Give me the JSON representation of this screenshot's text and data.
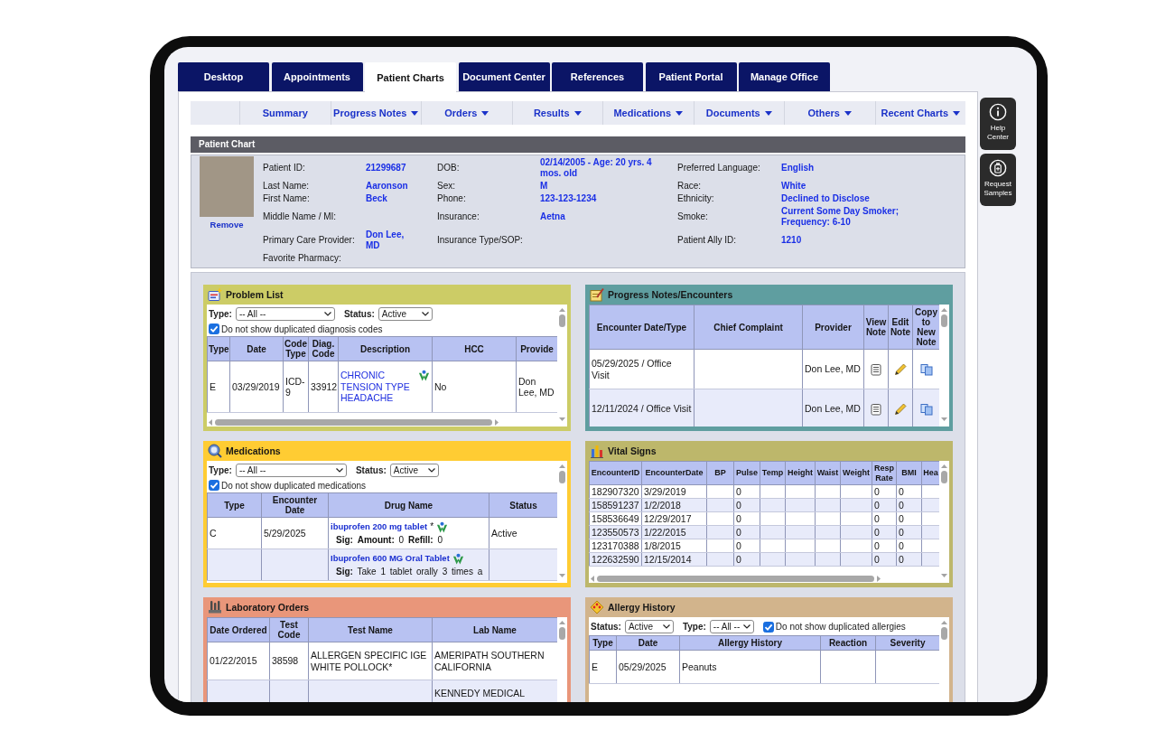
{
  "tabs": [
    {
      "label": "Desktop",
      "selected": false
    },
    {
      "label": "Appointments",
      "selected": false
    },
    {
      "label": "Patient Charts",
      "selected": true
    },
    {
      "label": "Document Center",
      "selected": false
    },
    {
      "label": "References",
      "selected": false
    },
    {
      "label": "Patient Portal",
      "selected": false
    },
    {
      "label": "Manage Office",
      "selected": false
    }
  ],
  "subnav": [
    {
      "label": "Summary",
      "dropdown": false
    },
    {
      "label": "Progress Notes",
      "dropdown": true
    },
    {
      "label": "Orders",
      "dropdown": true
    },
    {
      "label": "Results",
      "dropdown": true
    },
    {
      "label": "Medications",
      "dropdown": true
    },
    {
      "label": "Documents",
      "dropdown": true
    },
    {
      "label": "Others",
      "dropdown": true
    },
    {
      "label": "Recent Charts",
      "dropdown": true
    }
  ],
  "patient_chart": {
    "title": "Patient Chart",
    "photo_link": "Remove",
    "rows": [
      [
        {
          "label": "Patient ID:",
          "value": "21299687"
        },
        {
          "label": "DOB:",
          "value": "02/14/2005 - Age: 20 yrs. 4 mos. old"
        },
        {
          "label": "Preferred Language:",
          "value": "English"
        }
      ],
      [
        {
          "label": "Last Name:",
          "value": "Aaronson"
        },
        {
          "label": "Sex:",
          "value": "M"
        },
        {
          "label": "Race:",
          "value": "White"
        }
      ],
      [
        {
          "label": "First Name:",
          "value": "Beck"
        },
        {
          "label": "Phone:",
          "value": "123-123-1234"
        },
        {
          "label": "Ethnicity:",
          "value": "Declined to Disclose"
        }
      ],
      [
        {
          "label": "Middle Name / MI:"
        },
        {
          "label": "Insurance:",
          "value": "Aetna"
        },
        {
          "label": "Smoke:",
          "value": "Current Some Day Smoker; Frequency: 6-10"
        }
      ],
      [
        {
          "label": "Primary Care Provider:",
          "value": "Don Lee, MD"
        },
        {
          "label": "Insurance Type/SOP:"
        },
        {
          "label": "Patient Ally ID:",
          "value": "1210"
        }
      ],
      [
        {
          "label": "Favorite Pharmacy:"
        }
      ]
    ]
  },
  "widgets": [
    {
      "kind": "problems",
      "title": "Problem List",
      "color": "#cccc66",
      "controls": [
        {
          "kind": "select",
          "label": "Type:",
          "value": "-- All --"
        },
        {
          "kind": "select",
          "label": "Status:",
          "value": "Active"
        },
        {
          "kind": "checkbox",
          "label": "Do not show duplicated diagnosis codes",
          "checked": true
        }
      ],
      "columns": [
        "Type",
        "Date",
        "Code Type",
        "Diag. Code",
        "Description",
        "HCC",
        "Provide"
      ],
      "rows": [
        [
          "E",
          "03/29/2019",
          "ICD-9",
          "33912",
          {
            "kind": "link",
            "text": "CHRONIC TENSION TYPE HEADACHE",
            "logo": true
          },
          "No",
          "Don Lee, MD"
        ]
      ]
    },
    {
      "kind": "notes",
      "title": "Progress Notes/Encounters",
      "color": "#5f9ea0",
      "columns": [
        "Encounter Date/Type",
        "Chief Complaint",
        "Provider",
        "View Note",
        "Edit Note",
        "Copy to New Note"
      ],
      "rows": [
        [
          "05/29/2025 / Office Visit",
          null,
          "Don Lee, MD",
          {
            "kind": "view"
          },
          {
            "kind": "edit"
          },
          {
            "kind": "copy"
          }
        ],
        [
          "12/11/2024 / Office Visit",
          null,
          "Don Lee, MD",
          {
            "kind": "view"
          },
          {
            "kind": "edit"
          },
          {
            "kind": "copy"
          }
        ]
      ]
    },
    {
      "kind": "meds",
      "title": "Medications",
      "color": "#ffcc33",
      "controls": [
        {
          "kind": "select",
          "label": "Type:",
          "value": "-- All --"
        },
        {
          "kind": "select",
          "label": "Status:",
          "value": "Active"
        },
        {
          "kind": "checkbox",
          "label": "Do not show duplicated medications",
          "checked": true
        }
      ],
      "columns": [
        "Type",
        "Encounter Date",
        "Drug Name",
        "Status"
      ],
      "rows": [
        [
          "C",
          "5/29/2025",
          {
            "kind": "drug",
            "text": "ibuprofen 200 mg tablet",
            "note": "*",
            "logo": true,
            "sig": "**Sig:** **Amount:** 0 **Refill:** 0"
          },
          "Active"
        ],
        [
          null,
          null,
          {
            "kind": "drug",
            "text": "Ibuprofen 600 MG Oral Tablet",
            "logo": true,
            "sig": "**Sig:** Take 1 tablet orally 3 times a"
          },
          null
        ]
      ]
    },
    {
      "kind": "vitals",
      "title": "Vital Signs",
      "color": "#bdb76b",
      "columns": [
        "EncounterID",
        "EncounterDate",
        "BP",
        "Pulse",
        "Temp",
        "Height",
        "Waist",
        "Weight",
        "Resp Rate",
        "BMI",
        "Hea"
      ],
      "rows": [
        [
          "182907320",
          "3/29/2019",
          null,
          "0",
          null,
          null,
          null,
          null,
          "0",
          "0",
          null
        ],
        [
          "158591237",
          "1/2/2018",
          null,
          "0",
          null,
          null,
          null,
          null,
          "0",
          "0",
          null
        ],
        [
          "158536649",
          "12/29/2017",
          null,
          "0",
          null,
          null,
          null,
          null,
          "0",
          "0",
          null
        ],
        [
          "123550573",
          "1/22/2015",
          null,
          "0",
          null,
          null,
          null,
          null,
          "0",
          "0",
          null
        ],
        [
          "123170388",
          "1/8/2015",
          null,
          "0",
          null,
          null,
          null,
          null,
          "0",
          "0",
          null
        ],
        [
          "122632590",
          "12/15/2014",
          null,
          "0",
          null,
          null,
          null,
          null,
          "0",
          "0",
          null
        ]
      ]
    },
    {
      "kind": "labs",
      "title": "Laboratory Orders",
      "color": "#e9967a",
      "columns": [
        "Date Ordered",
        "Test Code",
        "Test Name",
        "Lab Name"
      ],
      "rows": [
        [
          "01/22/2015",
          "38598",
          "ALLERGEN SPECIFIC IGE WHITE POLLOCK*",
          "AMERIPATH SOUTHERN CALIFORNIA"
        ],
        [
          null,
          null,
          null,
          "KENNEDY MEDICAL"
        ]
      ]
    },
    {
      "kind": "allergies",
      "title": "Allergy History",
      "color": "#d2b48c",
      "controls": [
        {
          "kind": "select",
          "label": "Status:",
          "value": "Active"
        },
        {
          "kind": "select",
          "label": "Type:",
          "value": "-- All --"
        },
        {
          "kind": "checkbox",
          "label": "Do not show duplicated allergies",
          "checked": true
        }
      ],
      "columns": [
        "Type",
        "Date",
        "Allergy History",
        "Reaction",
        "Severity"
      ],
      "rows": [
        [
          "E",
          "05/29/2025",
          "Peanuts",
          null,
          null
        ]
      ]
    }
  ],
  "side_buttons": [
    {
      "label": "Help Center",
      "kind": "help"
    },
    {
      "label": "Request Samples",
      "kind": "samples"
    }
  ]
}
